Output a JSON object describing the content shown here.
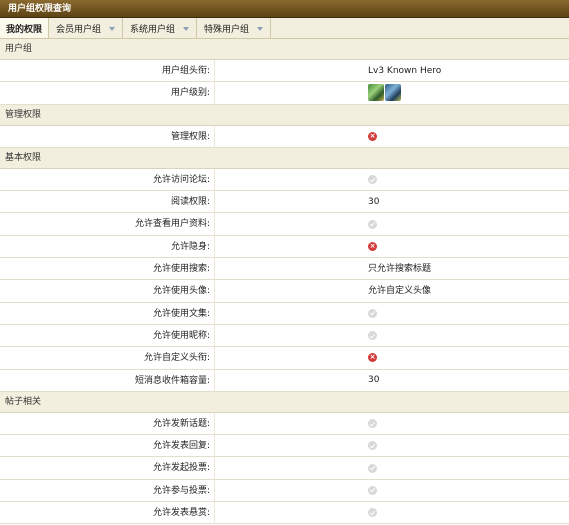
{
  "window": {
    "title": "用户组权限查询"
  },
  "tabs": [
    {
      "label": "我的权限",
      "active": true
    },
    {
      "label": "会员用户组",
      "active": false
    },
    {
      "label": "系统用户组",
      "active": false
    },
    {
      "label": "特殊用户组",
      "active": false
    }
  ],
  "sections": {
    "usergroup": "用户组",
    "admin": "管理权限",
    "basic": "基本权限",
    "posts": "帖子相关"
  },
  "rows": {
    "group_title": {
      "label": "用户组头衔:",
      "value": "Lv3 Known Hero"
    },
    "group_level": {
      "label": "用户级别:",
      "value_icon": "rank-stars-icon"
    },
    "admin_perm": {
      "label": "管理权限:",
      "value_icon": "denied-icon"
    },
    "visit_forum": {
      "label": "允许访问论坛:",
      "value_icon": "allowed-icon"
    },
    "read_perm": {
      "label": "阅读权限:",
      "value": "30"
    },
    "view_profile": {
      "label": "允许查看用户资料:",
      "value_icon": "allowed-icon"
    },
    "invisible": {
      "label": "允许隐身:",
      "value_icon": "denied-icon"
    },
    "search": {
      "label": "允许使用搜索:",
      "value": "只允许搜索标题"
    },
    "avatar": {
      "label": "允许使用头像:",
      "value": "允许自定义头像"
    },
    "collection": {
      "label": "允许使用文集:",
      "value_icon": "allowed-icon"
    },
    "nickname": {
      "label": "允许使用昵称:",
      "value_icon": "allowed-icon"
    },
    "custom_title": {
      "label": "允许自定义头衔:",
      "value_icon": "denied-icon"
    },
    "pm_capacity": {
      "label": "短消息收件箱容量:",
      "value": "30"
    },
    "new_topic": {
      "label": "允许发新话题:",
      "value_icon": "allowed-icon"
    },
    "reply": {
      "label": "允许发表回复:",
      "value_icon": "allowed-icon"
    },
    "start_poll": {
      "label": "允许发起投票:",
      "value_icon": "allowed-icon"
    },
    "vote": {
      "label": "允许参与投票:",
      "value_icon": "allowed-icon"
    },
    "reward": {
      "label": "允许发表悬赏:",
      "value_icon": "allowed-icon"
    }
  }
}
